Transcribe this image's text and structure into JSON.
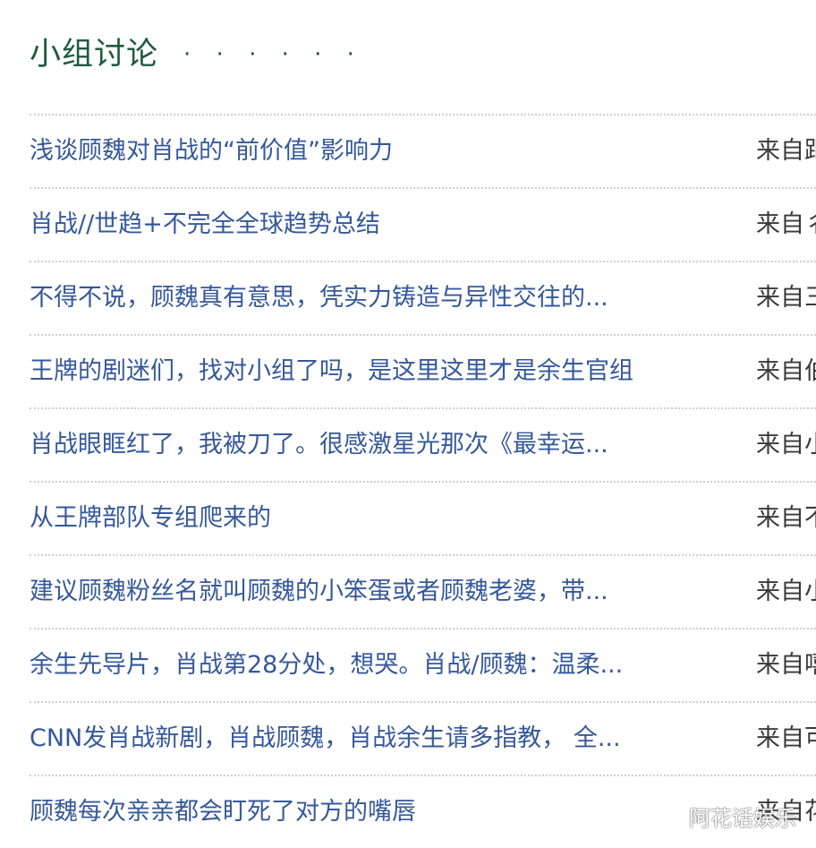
{
  "section": {
    "title": "小组讨论",
    "dots": "· · · · · ·"
  },
  "items": [
    {
      "title": "浅谈顾魏对肖战的“前价值”影响力",
      "source": "来自距"
    },
    {
      "title": "肖战//世趋+不完全全球趋势总结",
      "source": "来自彳"
    },
    {
      "title": "不得不说，顾魏真有意思，凭实力铸造与异性交往的...",
      "source": "来自三"
    },
    {
      "title": "王牌的剧迷们，找对小组了吗，是这里这里才是余生官组",
      "source": "来自伯"
    },
    {
      "title": "肖战眼眶红了，我被刀了。很感激星光那次《最幸运...",
      "source": "来自小"
    },
    {
      "title": "从王牌部队专组爬来的",
      "source": "来自不"
    },
    {
      "title": "建议顾魏粉丝名就叫顾魏的小笨蛋或者顾魏老婆，带...",
      "source": "来自小"
    },
    {
      "title": "余生先导片，肖战第28分处，想哭。肖战/顾魏：温柔...",
      "source": "来自嘻"
    },
    {
      "title": "CNN发肖战新剧，肖战顾魏，肖战余生请多指教， 全...",
      "source": "来自可"
    },
    {
      "title": "顾魏每次亲亲都会盯死了对方的嘴唇",
      "source": "来自花"
    }
  ],
  "watermark": "阿花话娱乐",
  "colors": {
    "title": "#1f5a3e",
    "link": "#35589b",
    "divider": "#cfcfcf"
  }
}
